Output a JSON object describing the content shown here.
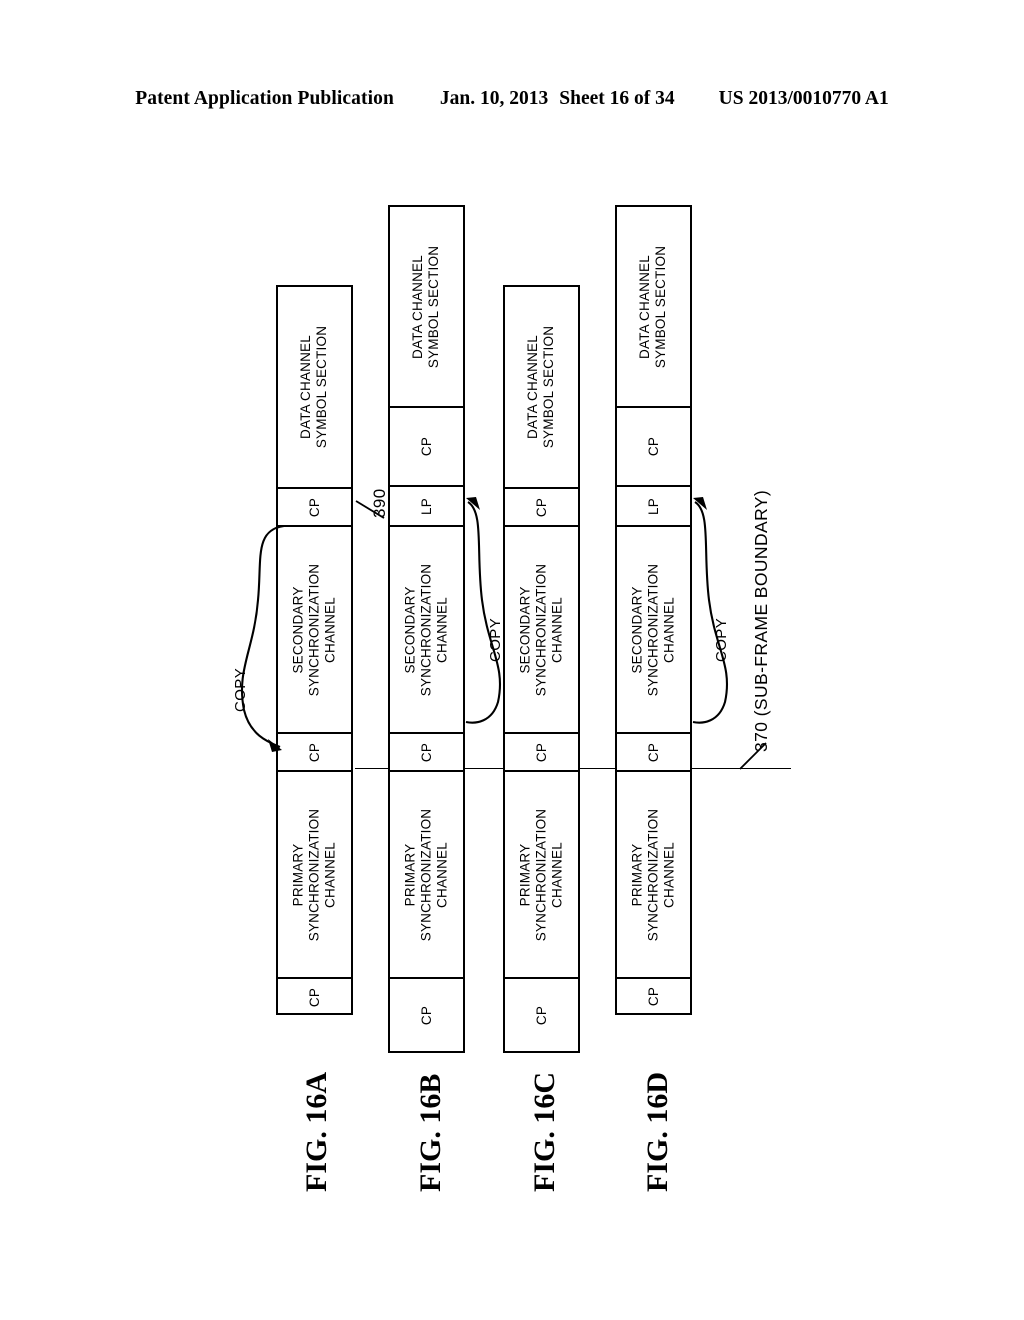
{
  "header": {
    "publication": "Patent Application Publication",
    "date": "Jan. 10, 2013",
    "sheet": "Sheet 16 of 34",
    "number": "US 2013/0010770 A1"
  },
  "figure": {
    "captions": [
      "FIG.  16A",
      "FIG.  16B",
      "FIG.  16C",
      "FIG.  16D"
    ],
    "annotations": {
      "copy": "COPY",
      "ref_390": "390",
      "ref_370": "370 (SUB-FRAME BOUNDARY)"
    },
    "segment_labels": {
      "cp": "CP",
      "lp": "LP",
      "primary": "PRIMARY\nSYNCHRONIZATION\nCHANNEL",
      "secondary": "SECONDARY\nSYNCHRONIZATION\nCHANNEL",
      "data": "DATA CHANNEL\nSYMBOL SECTION"
    },
    "rows": [
      {
        "id": "16A",
        "caption": "FIG.  16A",
        "segments": [
          {
            "name": "data-channel-symbol-section",
            "label": "DATA CHANNEL\nSYMBOL SECTION"
          },
          {
            "name": "cp",
            "label": "CP"
          },
          {
            "name": "secondary-synchronization-channel",
            "label": "SECONDARY\nSYNCHRONIZATION\nCHANNEL"
          },
          {
            "name": "cp",
            "label": "CP"
          },
          {
            "name": "primary-synchronization-channel",
            "label": "PRIMARY\nSYNCHRONIZATION\nCHANNEL"
          },
          {
            "name": "cp",
            "label": "CP"
          }
        ],
        "has_copy_arrow": true,
        "copy_direction": "down"
      },
      {
        "id": "16B",
        "caption": "FIG.  16B",
        "segments": [
          {
            "name": "data-channel-symbol-section",
            "label": "DATA CHANNEL\nSYMBOL SECTION"
          },
          {
            "name": "cp",
            "label": "CP"
          },
          {
            "name": "lp",
            "label": "LP"
          },
          {
            "name": "secondary-synchronization-channel",
            "label": "SECONDARY\nSYNCHRONIZATION\nCHANNEL"
          },
          {
            "name": "cp",
            "label": "CP"
          },
          {
            "name": "primary-synchronization-channel",
            "label": "PRIMARY\nSYNCHRONIZATION\nCHANNEL"
          },
          {
            "name": "cp",
            "label": "CP"
          }
        ],
        "has_copy_arrow": true,
        "copy_direction": "up"
      },
      {
        "id": "16C",
        "caption": "FIG.  16C",
        "segments": [
          {
            "name": "data-channel-symbol-section",
            "label": "DATA CHANNEL\nSYMBOL SECTION"
          },
          {
            "name": "cp",
            "label": "CP"
          },
          {
            "name": "secondary-synchronization-channel",
            "label": "SECONDARY\nSYNCHRONIZATION\nCHANNEL"
          },
          {
            "name": "cp",
            "label": "CP"
          },
          {
            "name": "primary-synchronization-channel",
            "label": "PRIMARY\nSYNCHRONIZATION\nCHANNEL"
          },
          {
            "name": "cp",
            "label": "CP"
          }
        ],
        "has_copy_arrow": false,
        "copy_direction": ""
      },
      {
        "id": "16D",
        "caption": "FIG.  16D",
        "segments": [
          {
            "name": "data-channel-symbol-section",
            "label": "DATA CHANNEL\nSYMBOL SECTION"
          },
          {
            "name": "cp",
            "label": "CP"
          },
          {
            "name": "lp",
            "label": "LP"
          },
          {
            "name": "secondary-synchronization-channel",
            "label": "SECONDARY\nSYNCHRONIZATION\nCHANNEL"
          },
          {
            "name": "cp",
            "label": "CP"
          },
          {
            "name": "primary-synchronization-channel",
            "label": "PRIMARY\nSYNCHRONIZATION\nCHANNEL"
          },
          {
            "name": "cp",
            "label": "CP"
          }
        ],
        "has_copy_arrow": true,
        "copy_direction": "up"
      }
    ]
  },
  "colors": {
    "ink": "#000000",
    "page": "#ffffff"
  }
}
